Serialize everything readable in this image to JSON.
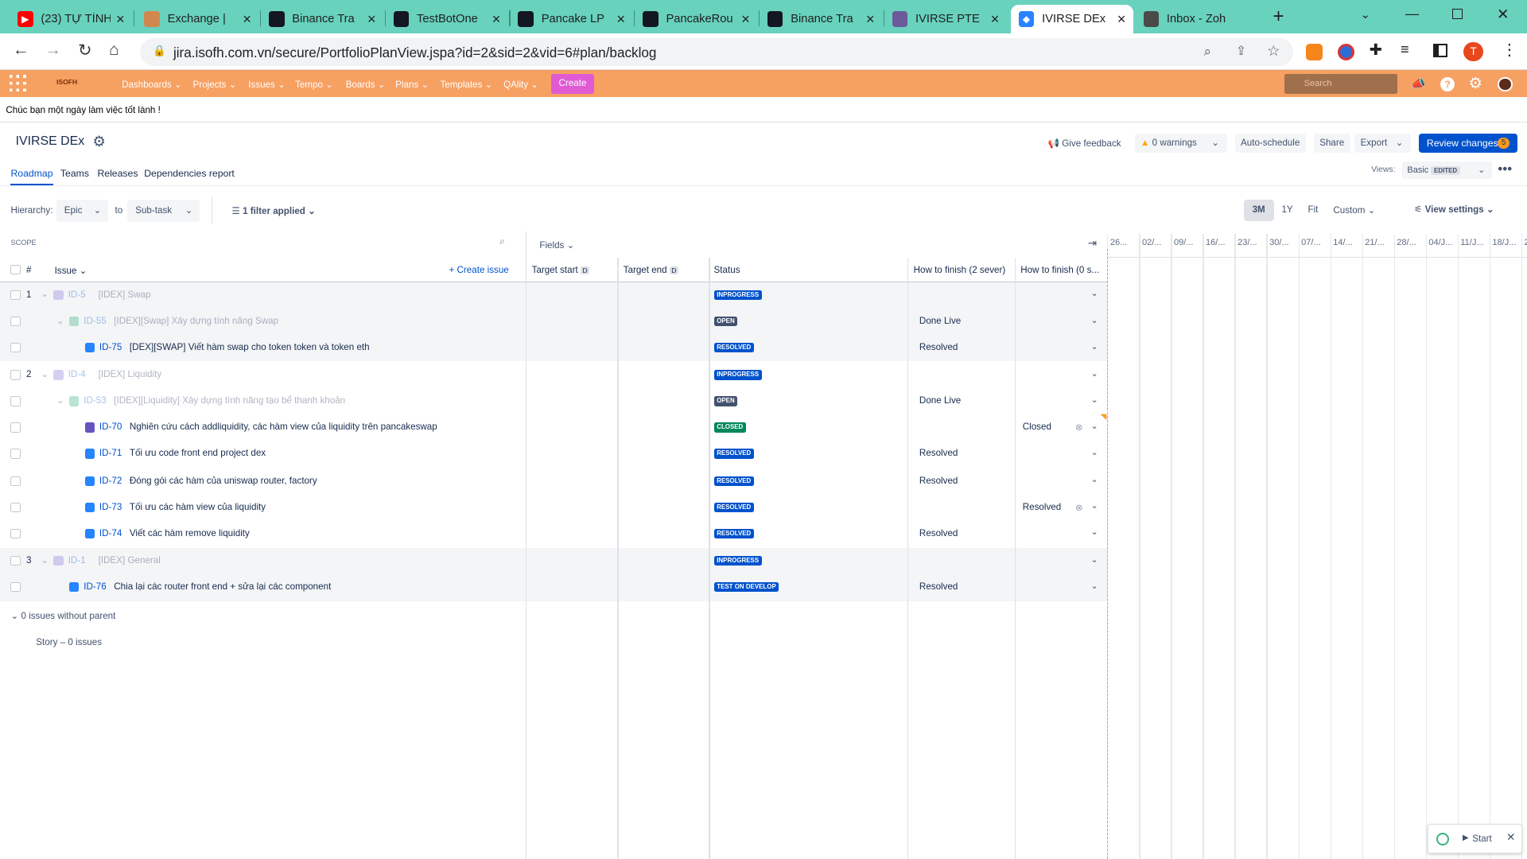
{
  "browser": {
    "tabs": [
      {
        "title": "(23) TỰ TÌNH",
        "icon": "youtube-icon",
        "color": "#ff0000"
      },
      {
        "title": "Exchange |",
        "icon": "pancake-icon",
        "color": "#d1884f"
      },
      {
        "title": "Binance Tra",
        "icon": "tradingview-icon",
        "color": "#131722"
      },
      {
        "title": "TestBotOne",
        "icon": "tradingview-icon",
        "color": "#131722"
      },
      {
        "title": "Pancake LP",
        "icon": "tradingview-icon",
        "color": "#131722"
      },
      {
        "title": "PancakeRou",
        "icon": "tradingview-icon",
        "color": "#131722"
      },
      {
        "title": "Binance Tra",
        "icon": "tradingview-icon",
        "color": "#131722"
      },
      {
        "title": "IVIRSE PTE",
        "icon": "ivirse-icon",
        "color": "#6b5b9a"
      },
      {
        "title": "IVIRSE DEx",
        "icon": "jira-icon",
        "color": "#2684ff"
      },
      {
        "title": "Inbox - Zoh",
        "icon": "mail-icon",
        "color": "#4a4a4a"
      }
    ],
    "url": "jira.isofh.com.vn/secure/PortfolioPlanView.jspa?id=2&sid=2&vid=6#plan/backlog",
    "profile_initial": "T"
  },
  "jira": {
    "logo_text": "ISOFH",
    "nav": [
      "Dashboards",
      "Projects",
      "Issues",
      "Tempo",
      "Boards",
      "Plans",
      "Templates",
      "QAlity"
    ],
    "create": "Create",
    "search_placeholder": "Search"
  },
  "greeting": "Chúc bạn một ngày làm việc tốt lành !",
  "plan": {
    "title": "IVIRSE DEx",
    "tabs": [
      "Roadmap",
      "Teams",
      "Releases",
      "Dependencies report"
    ],
    "give_feedback": "Give feedback",
    "warnings": "0 warnings",
    "auto_schedule": "Auto-schedule",
    "share": "Share",
    "export": "Export",
    "review_changes": "Review changes",
    "review_count": "5",
    "views_label": "Views:",
    "view_name": "Basic",
    "view_badge": "EDITED"
  },
  "controls": {
    "hierarchy_label": "Hierarchy:",
    "from": "Epic",
    "to_label": "to",
    "to": "Sub-task",
    "filter": "1 filter applied",
    "zoom": [
      "3M",
      "1Y",
      "Fit",
      "Custom"
    ],
    "view_settings": "View settings"
  },
  "table": {
    "scope_label": "SCOPE",
    "fields_label": "Fields",
    "hash": "#",
    "issue_col": "Issue",
    "create_issue": "Create issue",
    "target_start": "Target start",
    "target_end": "Target end",
    "d_badge": "D",
    "status": "Status",
    "how1": "How to finish (2 sever)",
    "how2": "How to finish (0 s..."
  },
  "timeline": [
    "26...",
    "02/...",
    "09/...",
    "16/...",
    "23/...",
    "30/...",
    "07/...",
    "14/...",
    "21/...",
    "28/...",
    "04/J...",
    "11/J...",
    "18/J...",
    "2"
  ],
  "rows": [
    {
      "num": "1",
      "key": "ID-5",
      "summary": "[IDEX] Swap",
      "status": "INPROGRESS",
      "lz": "blue",
      "level": 0,
      "faded": true,
      "type": "#8777d9",
      "how1": "",
      "how2": "",
      "grey": true
    },
    {
      "num": "",
      "key": "ID-55",
      "summary": "[IDEX][Swap] Xây dựng tính năng Swap",
      "status": "OPEN",
      "lz": "dark",
      "level": 1,
      "faded": true,
      "type": "#36b37e",
      "how1": "Done Live",
      "how2": "",
      "grey": true
    },
    {
      "num": "",
      "key": "ID-75",
      "summary": "[DEX][SWAP] Viết hàm swap cho token token và token eth",
      "status": "RESOLVED",
      "lz": "blue",
      "level": 2,
      "faded": false,
      "type": "#2684ff",
      "how1": "Resolved",
      "how2": "",
      "grey": true
    },
    {
      "num": "2",
      "key": "ID-4",
      "summary": "[IDEX] Liquidity",
      "status": "INPROGRESS",
      "lz": "blue",
      "level": 0,
      "faded": true,
      "type": "#8777d9",
      "how1": "",
      "how2": "",
      "grey": false
    },
    {
      "num": "",
      "key": "ID-53",
      "summary": "[IDEX][Liquidity] Xây dựng tính năng tạo bể thanh khoản",
      "status": "OPEN",
      "lz": "dark",
      "level": 1,
      "faded": true,
      "type": "#36b37e",
      "how1": "Done Live",
      "how2": "",
      "grey": false
    },
    {
      "num": "",
      "key": "ID-70",
      "summary": "Nghiên cứu cách addliquidity, các hàm view của liquidity trên pancakeswap",
      "status": "CLOSED",
      "lz": "green",
      "level": 2,
      "faded": false,
      "type": "#6554c0",
      "how1": "",
      "how2": "Closed",
      "grey": false
    },
    {
      "num": "",
      "key": "ID-71",
      "summary": "Tối ưu code front end project dex",
      "status": "RESOLVED",
      "lz": "blue",
      "level": 2,
      "faded": false,
      "type": "#2684ff",
      "how1": "Resolved",
      "how2": "",
      "grey": false
    },
    {
      "num": "",
      "key": "ID-72",
      "summary": "Đóng gói các hàm của uniswap router, factory",
      "status": "RESOLVED",
      "lz": "blue",
      "level": 2,
      "faded": false,
      "type": "#2684ff",
      "how1": "Resolved",
      "how2": "",
      "grey": false
    },
    {
      "num": "",
      "key": "ID-73",
      "summary": "Tối ưu các hàm view của liquidity",
      "status": "RESOLVED",
      "lz": "blue",
      "level": 2,
      "faded": false,
      "type": "#2684ff",
      "how1": "",
      "how2": "Resolved",
      "grey": false
    },
    {
      "num": "",
      "key": "ID-74",
      "summary": "Viết các hàm remove liquidity",
      "status": "RESOLVED",
      "lz": "blue",
      "level": 2,
      "faded": false,
      "type": "#2684ff",
      "how1": "Resolved",
      "how2": "",
      "grey": false
    },
    {
      "num": "3",
      "key": "ID-1",
      "summary": "[IDEX] General",
      "status": "INPROGRESS",
      "lz": "blue",
      "level": 0,
      "faded": true,
      "type": "#8777d9",
      "how1": "",
      "how2": "",
      "grey": true
    },
    {
      "num": "",
      "key": "ID-76",
      "summary": "Chia lại các router front end + sửa lại các component",
      "status": "TEST ON DEVELOP",
      "lz": "blue",
      "level": 1,
      "faded": false,
      "type": "#2684ff",
      "how1": "Resolved",
      "how2": "",
      "grey": true
    }
  ],
  "footer": {
    "no_parent": "0 issues without parent",
    "story": "Story – 0 issues",
    "start": "Start"
  }
}
